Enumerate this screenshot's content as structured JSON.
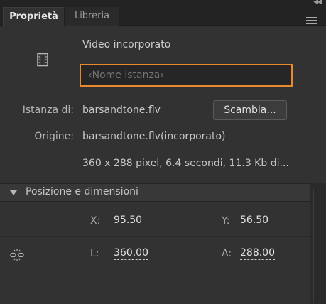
{
  "tabs": [
    {
      "label": "Proprietà",
      "active": true
    },
    {
      "label": "Libreria",
      "active": false
    }
  ],
  "header": {
    "symbol_icon": "film-strip-icon",
    "symbol_type": "Video incorporato",
    "instance_name_placeholder": "‹Nome istanza›"
  },
  "instance": {
    "instance_of_label": "Istanza di:",
    "instance_of_value": "barsandtone.flv",
    "swap_button": "Scambia...",
    "origin_label": "Origine:",
    "origin_value": "barsandtone.flv(incorporato)",
    "info": "360 x 288 pixel, 6.4 secondi, 11.3 Kb di..."
  },
  "position_size": {
    "title": "Posizione e dimensioni",
    "x_label": "X:",
    "x_value": "95.50",
    "y_label": "Y:",
    "y_value": "56.50",
    "w_label": "L:",
    "w_value": "360.00",
    "h_label": "A:",
    "h_value": "288.00",
    "link_icon": "link-dimensions-icon"
  },
  "colors": {
    "accent": "#e8892e",
    "panel": "#323232",
    "background": "#2b2b2b"
  }
}
